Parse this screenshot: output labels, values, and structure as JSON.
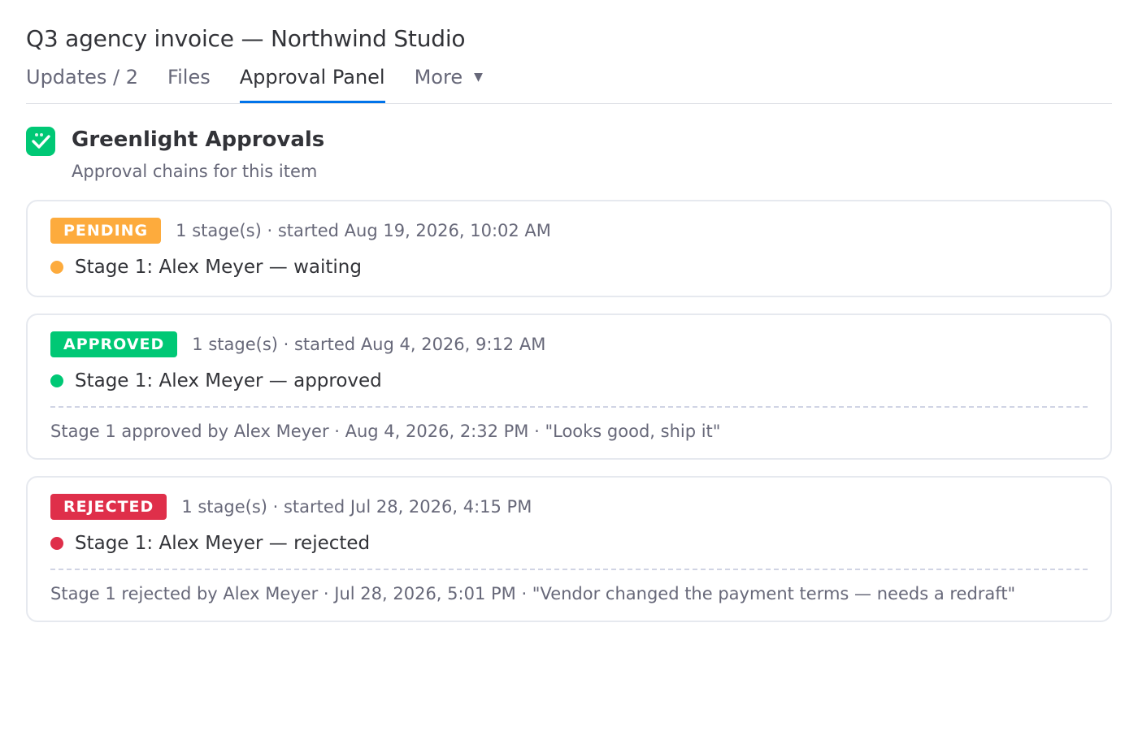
{
  "item": {
    "title": "Q3 agency invoice — Northwind Studio"
  },
  "tabs": [
    {
      "label": "Updates / 2",
      "active": false
    },
    {
      "label": "Files",
      "active": false
    },
    {
      "label": "Approval Panel",
      "active": true
    },
    {
      "label": "More",
      "active": false
    }
  ],
  "app": {
    "name": "Greenlight Approvals",
    "subtitle": "Approval chains for this item",
    "logo_icon": "check-face-icon",
    "brand_color": "#00c875"
  },
  "chains": [
    {
      "status": "PENDING",
      "status_color": "#fdab3d",
      "meta": "1 stage(s) · started Aug 19, 2026, 10:02 AM",
      "stage": "Stage 1: Alex Meyer — waiting",
      "history": null
    },
    {
      "status": "APPROVED",
      "status_color": "#00c875",
      "meta": "1 stage(s) · started Aug 4, 2026, 9:12 AM",
      "stage": "Stage 1: Alex Meyer — approved",
      "history": "Stage 1 approved by Alex Meyer · Aug 4, 2026, 2:32 PM · \"Looks good, ship it\""
    },
    {
      "status": "REJECTED",
      "status_color": "#df2f4a",
      "meta": "1 stage(s) · started Jul 28, 2026, 4:15 PM",
      "stage": "Stage 1: Alex Meyer — rejected",
      "history": "Stage 1 rejected by Alex Meyer · Jul 28, 2026, 5:01 PM · \"Vendor changed the payment terms — needs a redraft\""
    }
  ]
}
